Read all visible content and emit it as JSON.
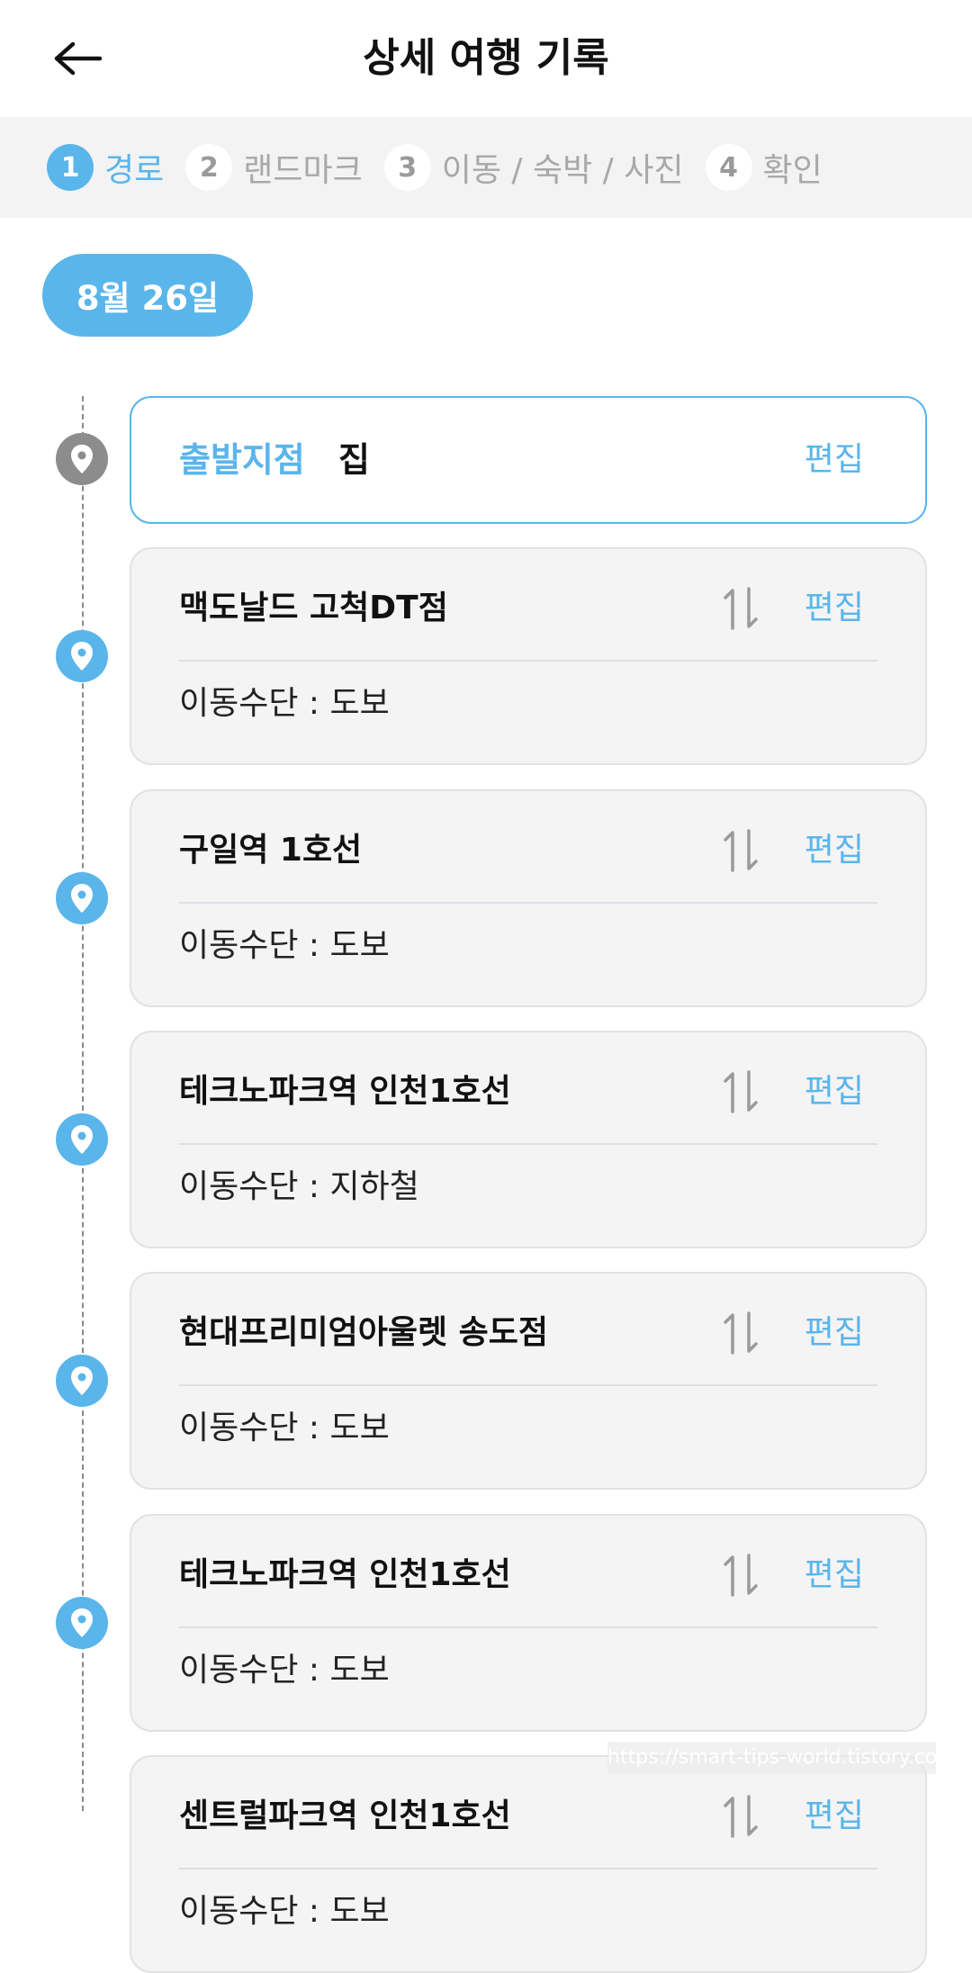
{
  "header": {
    "title": "상세 여행 기록",
    "back_icon": "arrow-left-icon"
  },
  "steps": [
    {
      "num": "1",
      "label": "경로",
      "active": true
    },
    {
      "num": "2",
      "label": "랜드마크",
      "active": false
    },
    {
      "num": "3",
      "label": "이동 / 숙박 / 사진",
      "active": false
    },
    {
      "num": "4",
      "label": "확인",
      "active": false
    }
  ],
  "date": "8월 26일",
  "start": {
    "label": "출발지점",
    "value": "집",
    "edit": "편집"
  },
  "stops": [
    {
      "name": "맥도날드 고척DT점",
      "transport": "이동수단 : 도보",
      "edit": "편집"
    },
    {
      "name": "구일역 1호선",
      "transport": "이동수단 : 도보",
      "edit": "편집"
    },
    {
      "name": "테크노파크역 인천1호선",
      "transport": "이동수단 : 지하철",
      "edit": "편집"
    },
    {
      "name": "현대프리미엄아울렛 송도점",
      "transport": "이동수단 : 도보",
      "edit": "편집"
    },
    {
      "name": "테크노파크역 인천1호선",
      "transport": "이동수단 : 도보",
      "edit": "편집"
    },
    {
      "name": "센트럴파크역 인천1호선",
      "transport": "이동수단 : 도보",
      "edit": "편집"
    }
  ],
  "watermark": "https://smart-tips-world.tistory.com",
  "colors": {
    "accent": "#5ab5ea",
    "card_bg": "#f4f4f5",
    "marker_start": "#8c8c8c"
  }
}
